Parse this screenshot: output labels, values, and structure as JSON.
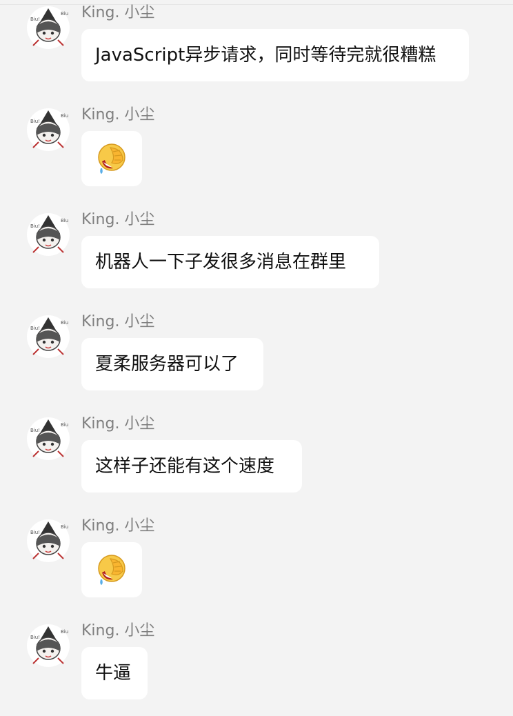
{
  "messages": [
    {
      "sender": "King. 小尘",
      "type": "text",
      "text": "JavaScript异步请求，同时等待完就很糟糕"
    },
    {
      "sender": "King. 小尘",
      "type": "emoji",
      "emoji": "facepalm-laugh-emoji"
    },
    {
      "sender": "King. 小尘",
      "type": "text",
      "text": "机器人一下子发很多消息在群里"
    },
    {
      "sender": "King. 小尘",
      "type": "text",
      "text": "夏柔服务器可以了"
    },
    {
      "sender": "King. 小尘",
      "type": "text",
      "text": "这样子还能有这个速度"
    },
    {
      "sender": "King. 小尘",
      "type": "emoji",
      "emoji": "facepalm-laugh-emoji"
    },
    {
      "sender": "King. 小尘",
      "type": "text",
      "text": "牛逼"
    }
  ],
  "colors": {
    "background": "#f3f3f3",
    "bubble": "#ffffff",
    "sender_text": "#7f7f7f",
    "message_text": "#111111"
  }
}
